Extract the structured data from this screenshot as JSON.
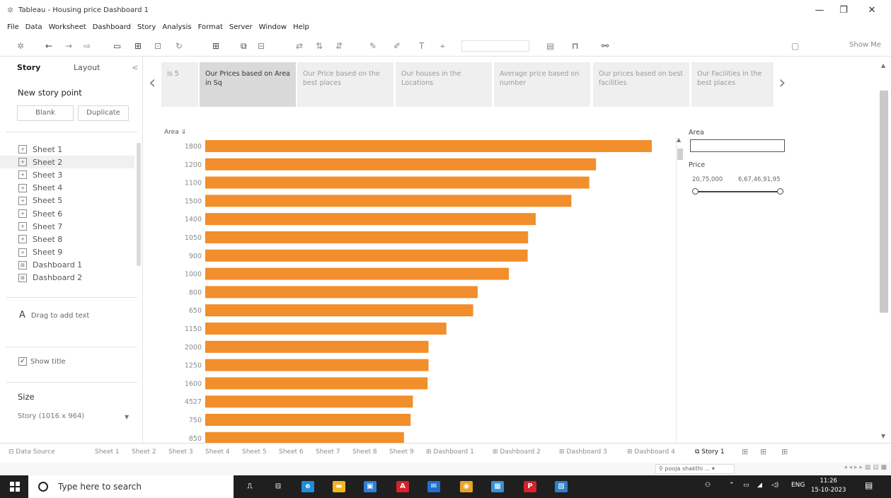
{
  "window": {
    "title": "Tableau - Housing price Dashboard 1",
    "minimize": "—",
    "restore": "❐",
    "close": "✕"
  },
  "menu": [
    "File",
    "Data",
    "Worksheet",
    "Dashboard",
    "Story",
    "Analysis",
    "Format",
    "Server",
    "Window",
    "Help"
  ],
  "toolbar": {
    "show_me": "Show Me"
  },
  "left_pane": {
    "tab_story": "Story",
    "tab_layout": "Layout",
    "collapse": "<",
    "new_story_point": "New story point",
    "blank_button": "Blank",
    "duplicate_button": "Duplicate",
    "sheets": [
      "Sheet 1",
      "Sheet 2",
      "Sheet 3",
      "Sheet 4",
      "Sheet 5",
      "Sheet 6",
      "Sheet 7",
      "Sheet 8",
      "Sheet 9",
      "Dashboard 1",
      "Dashboard 2"
    ],
    "selected_sheet": 1,
    "drag_text": "Drag to add text",
    "show_title": "Show title",
    "size_header": "Size",
    "size_value": "Story (1016 x 964)"
  },
  "story_points": [
    {
      "label": "is 5"
    },
    {
      "label": "Our Prices based on Area in Sq",
      "active": true
    },
    {
      "label": "Our Price based on the best places"
    },
    {
      "label": "Our houses in the Locations"
    },
    {
      "label": "Average price based on number"
    },
    {
      "label": "Our prices based on best facilities"
    },
    {
      "label": "Our Facilities in the best places"
    }
  ],
  "filters": {
    "area_label": "Area",
    "price_label": "Price",
    "price_min": "20,75,000",
    "price_max": "6,67,46,91,95"
  },
  "chart_data": {
    "type": "bar",
    "orientation": "horizontal",
    "row_header": "Area",
    "categories": [
      "1800",
      "1200",
      "1100",
      "1500",
      "1400",
      "1050",
      "900",
      "1000",
      "800",
      "650",
      "1150",
      "2000",
      "1250",
      "1600",
      "4527",
      "750",
      "850"
    ],
    "values": [
      100,
      87.5,
      86,
      82,
      74,
      72.3,
      72.2,
      68,
      61,
      60,
      54,
      50,
      50,
      49.8,
      46.5,
      46,
      44.5
    ],
    "bar_color": "#F28E2B",
    "grid": false
  },
  "bottom_tabs": [
    "Data Source",
    "Sheet 1",
    "Sheet 2",
    "Sheet 3",
    "Sheet 4",
    "Sheet 5",
    "Sheet 6",
    "Sheet 7",
    "Sheet 8",
    "Sheet 9",
    "Dashboard 1",
    "Dashboard 2",
    "Dashboard 3",
    "Dashboard 4",
    "Story 1"
  ],
  "active_bottom_tab": "Story 1",
  "status": {
    "user": "pooja shakthi ..."
  },
  "taskbar": {
    "search_placeholder": "Type here to search",
    "lang": "ENG",
    "time": "11:26",
    "date": "15-10-2023"
  }
}
